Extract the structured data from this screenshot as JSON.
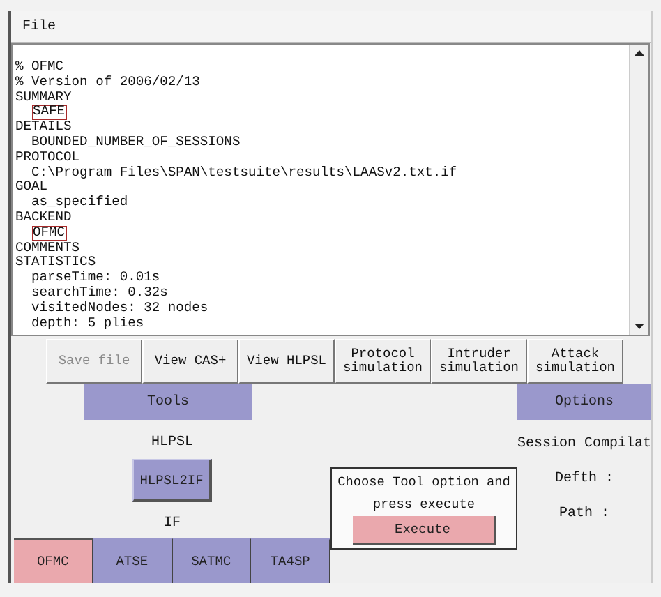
{
  "menu": [
    "File"
  ],
  "output_lines": [
    {
      "text": "% OFMC",
      "boxed": false
    },
    {
      "text": "% Version of 2006/02/13",
      "boxed": false
    },
    {
      "text": "SUMMARY",
      "boxed": false
    },
    {
      "text": "  SAFE",
      "boxed": true
    },
    {
      "text": "DETAILS",
      "boxed": false
    },
    {
      "text": "  BOUNDED_NUMBER_OF_SESSIONS",
      "boxed": false
    },
    {
      "text": "PROTOCOL",
      "boxed": false
    },
    {
      "text": "  C:\\Program Files\\SPAN\\testsuite\\results\\LAASv2.txt.if",
      "boxed": false
    },
    {
      "text": "GOAL",
      "boxed": false
    },
    {
      "text": "  as_specified",
      "boxed": false
    },
    {
      "text": "BACKEND",
      "boxed": false
    },
    {
      "text": "  OFMC",
      "boxed": true
    },
    {
      "text": "COMMENTS",
      "boxed": false
    },
    {
      "text": "STATISTICS",
      "boxed": false
    },
    {
      "text": "  parseTime: 0.01s",
      "boxed": false
    },
    {
      "text": "  searchTime: 0.32s",
      "boxed": false
    },
    {
      "text": "  visitedNodes: 32 nodes",
      "boxed": false
    },
    {
      "text": "  depth: 5 plies",
      "boxed": false
    }
  ],
  "action_buttons": [
    {
      "label": "Save file",
      "disabled": true
    },
    {
      "label": "View CAS+",
      "disabled": false
    },
    {
      "label": "View HLPSL",
      "disabled": false
    },
    {
      "label": "Protocol simulation",
      "disabled": false
    },
    {
      "label": "Intruder simulation",
      "disabled": false
    },
    {
      "label": "Attack simulation",
      "disabled": false
    }
  ],
  "tools": {
    "header": "Tools",
    "input_label": "HLPSL",
    "translate_button": "HLPSL2IF",
    "output_label": "IF",
    "backends": [
      {
        "label": "OFMC",
        "selected": true
      },
      {
        "label": "ATSE",
        "selected": false
      },
      {
        "label": "SATMC",
        "selected": false
      },
      {
        "label": "TA4SP",
        "selected": false
      }
    ]
  },
  "execute_panel": {
    "message": "Choose Tool option and press execute",
    "button": "Execute"
  },
  "options": {
    "header": "Options",
    "labels": [
      "Session Compilat",
      "Defth :",
      "Path :"
    ]
  }
}
